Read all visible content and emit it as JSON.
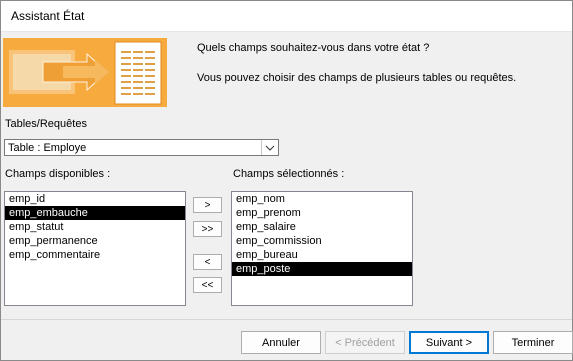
{
  "window": {
    "title": "Assistant État"
  },
  "intro": {
    "question": "Quels champs souhaitez-vous dans votre état ?",
    "hint": "Vous pouvez choisir des champs de plusieurs tables ou requêtes."
  },
  "tables": {
    "label": "Tables/Requêtes",
    "selected": "Table : Employe"
  },
  "available": {
    "label": "Champs disponibles :",
    "items": [
      "emp_id",
      "emp_embauche",
      "emp_statut",
      "emp_permanence",
      "emp_commentaire"
    ],
    "selected_index": 1
  },
  "selected_fields": {
    "label": "Champs sélectionnés :",
    "items": [
      "emp_nom",
      "emp_prenom",
      "emp_salaire",
      "emp_commission",
      "emp_bureau",
      "emp_poste"
    ],
    "selected_index": 5
  },
  "move_buttons": {
    "add_one": ">",
    "add_all": ">>",
    "remove_one": "<",
    "remove_all": "<<"
  },
  "footer": {
    "cancel": "Annuler",
    "previous": "< Précédent",
    "next": "Suivant >",
    "finish": "Terminer"
  },
  "colors": {
    "banner": "#f7ab3e",
    "selection": "#000000",
    "default_button_border": "#0078d4"
  }
}
